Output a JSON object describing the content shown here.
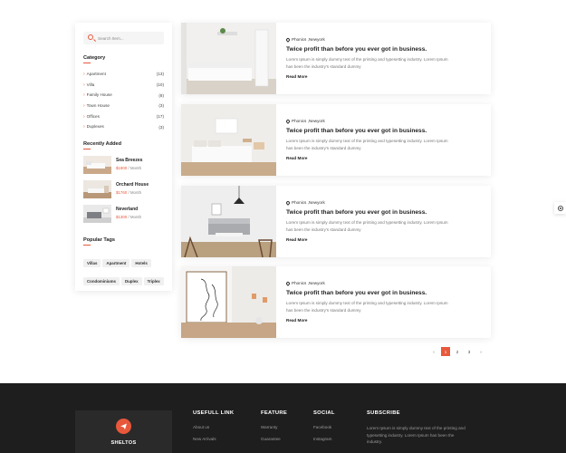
{
  "sidebar": {
    "search_placeholder": "Search Item...",
    "category_title": "Category",
    "categories": [
      {
        "name": "Apartment",
        "count": "(13)"
      },
      {
        "name": "Villa",
        "count": "(10)"
      },
      {
        "name": "Family House",
        "count": "(8)"
      },
      {
        "name": "Town House",
        "count": "(3)"
      },
      {
        "name": "Offices",
        "count": "(17)"
      },
      {
        "name": "Duplexes",
        "count": "(3)"
      }
    ],
    "recent_title": "Recently Added",
    "recent": [
      {
        "title": "Sea Breezes",
        "price": "$1900",
        "per": " / Month"
      },
      {
        "title": "Orchard House",
        "price": "$1760",
        "per": " / Month"
      },
      {
        "title": "Neverland",
        "price": "$1300",
        "per": " / Month"
      }
    ],
    "tags_title": "Popular Tags",
    "tags": [
      "Villas",
      "Apartment",
      "Hotels",
      "Condominiums",
      "Duplex",
      "Triplex"
    ]
  },
  "listings": [
    {
      "location": "Phonics ,Newyork",
      "title": "Twice profit than before you ever got in business.",
      "desc": "Lorem Ipsum is simply dummy text of the printing and typesetting industry. Lorem Ipsum has been the industry's standard dummy",
      "link": "Read More",
      "img": "bedroom-1"
    },
    {
      "location": "Phonics ,Newyork",
      "title": "Twice profit than before you ever got in business.",
      "desc": "Lorem Ipsum is simply dummy text of the printing and typesetting industry. Lorem Ipsum has been the industry's standard dummy",
      "link": "Read More",
      "img": "bedroom-2"
    },
    {
      "location": "Phonics ,Newyork",
      "title": "Twice profit than before you ever got in business.",
      "desc": "Lorem Ipsum is simply dummy text of the printing and typesetting industry. Lorem Ipsum has been the industry's standard dummy",
      "link": "Read More",
      "img": "living-room"
    },
    {
      "location": "Phonics ,Newyork",
      "title": "Twice profit than before you ever got in business.",
      "desc": "Lorem Ipsum is simply dummy text of the printing and typesetting industry. Lorem Ipsum has been the industry's standard dummy",
      "link": "Read More",
      "img": "line-art-interior"
    }
  ],
  "pagination": {
    "prev": "‹",
    "pages": [
      "1",
      "2",
      "3"
    ],
    "active": "1",
    "next": "›"
  },
  "side_tab_icon": "gear-icon",
  "footer": {
    "brand": "SHELTOS",
    "logo_icon": "send-icon",
    "cols": [
      {
        "title": "USEFULL LINK",
        "links": [
          "About us",
          "New Arrivals"
        ]
      },
      {
        "title": "FEATURE",
        "links": [
          "Warranty",
          "Guarantee"
        ]
      },
      {
        "title": "SOCIAL",
        "links": [
          "Facebook",
          "Instagram"
        ]
      }
    ],
    "subscribe_title": "SUBSCRIBE",
    "subscribe_text": "Lorem Ipsum is simply dummy text of the printing and typesetting industry. Lorem Ipsum has been the industry."
  },
  "colors": {
    "accent": "#e8583b",
    "footer_bg": "#1e1e1e"
  }
}
